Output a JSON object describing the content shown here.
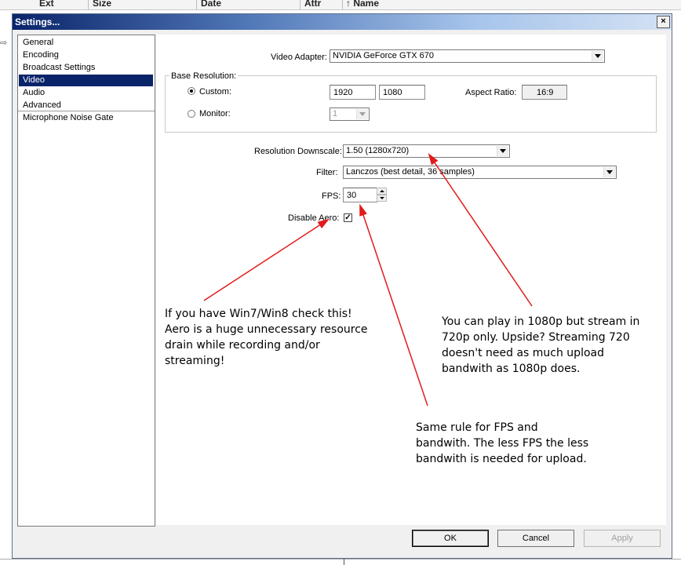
{
  "background_list": {
    "columns": [
      "Ext",
      "Size",
      "Date",
      "Attr",
      "Name"
    ]
  },
  "dialog": {
    "title": "Settings...",
    "close_glyph": "×"
  },
  "sidebar": {
    "items": [
      {
        "label": "General",
        "selected": false
      },
      {
        "label": "Encoding",
        "selected": false
      },
      {
        "label": "Broadcast Settings",
        "selected": false
      },
      {
        "label": "Video",
        "selected": true
      },
      {
        "label": "Audio",
        "selected": false
      },
      {
        "label": "Advanced",
        "selected": false
      },
      {
        "label": "Microphone Noise Gate",
        "selected": false
      }
    ]
  },
  "video": {
    "adapter_label": "Video Adapter:",
    "adapter_value": "NVIDIA GeForce GTX 670",
    "base_resolution": {
      "group_label": "Base Resolution:",
      "custom_label": "Custom:",
      "custom_selected": true,
      "width": "1920",
      "height": "1080",
      "aspect_label": "Aspect Ratio:",
      "aspect_value": "16:9",
      "monitor_label": "Monitor:",
      "monitor_value": "1"
    },
    "downscale_label": "Resolution Downscale:",
    "downscale_value": "1.50  (1280x720)",
    "filter_label": "Filter:",
    "filter_value": "Lanczos (best detail, 36 samples)",
    "fps_label": "FPS:",
    "fps_value": "30",
    "aero_label": "Disable Aero:",
    "aero_checked": true,
    "aero_check_glyph": "✓"
  },
  "annotations": {
    "aero_note": "If you have Win7/Win8 check this!\nAero is a huge unnecessary resource\ndrain while recording and/or\nstreaming!",
    "resolution_note": "You can play in 1080p but stream in\n720p only. Upside? Streaming 720\ndoesn't need as much upload\nbandwith as 1080p does.",
    "fps_note": "Same rule for FPS and\nbandwith. The less FPS the less\nbandwith is needed for upload.",
    "arrow_color": "#e11b1b"
  },
  "buttons": {
    "ok": "OK",
    "cancel": "Cancel",
    "apply": "Apply"
  }
}
